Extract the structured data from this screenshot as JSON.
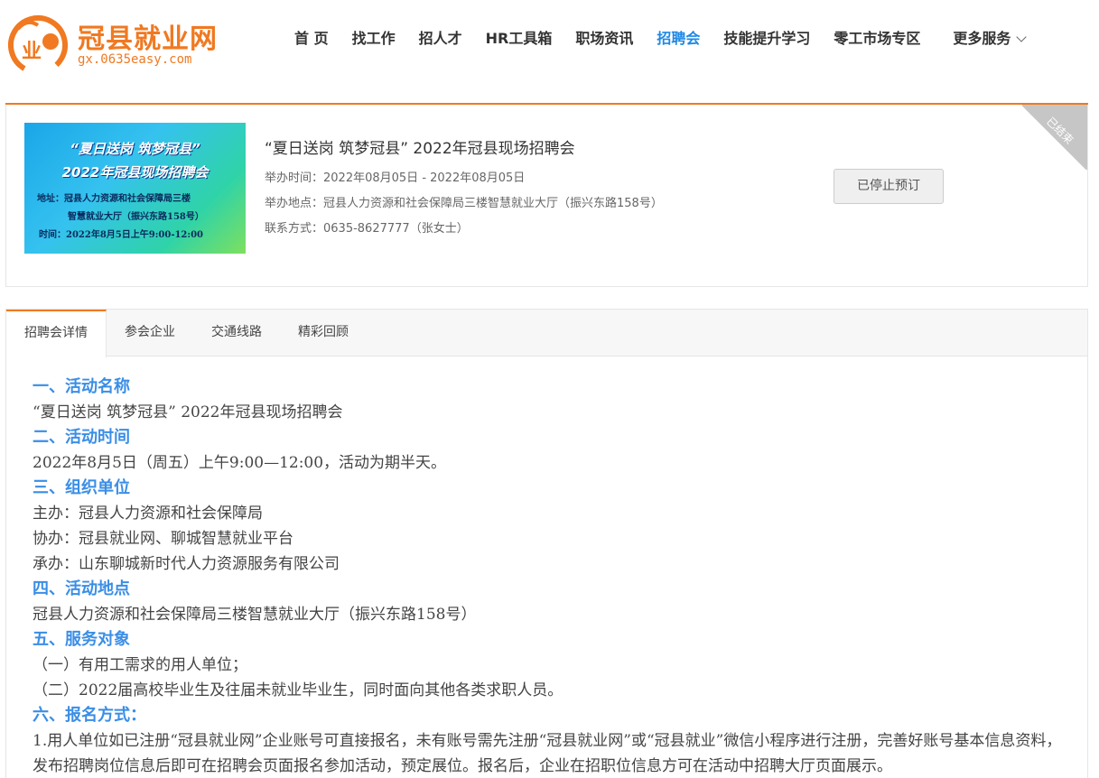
{
  "header": {
    "logo_title": "冠县就业网",
    "logo_url": "gx.0635easy.com",
    "logo_mark_text": "业",
    "nav": [
      "首 页",
      "找工作",
      "招人才",
      "HR工具箱",
      "职场资讯",
      "招聘会",
      "技能提升学习",
      "零工市场专区"
    ],
    "nav_active": "招聘会",
    "more_label": "更多服务"
  },
  "fair": {
    "banner": {
      "line1": "“夏日送岗  筑梦冠县”",
      "line2": "2022年冠县现场招聘会",
      "line3": "地址：冠县人力资源和社会保障局三楼",
      "line4": "智慧就业大厅（振兴东路158号）",
      "line5": "时间：2022年8月5日上午9:00-12:00"
    },
    "title": "“夏日送岗 筑梦冠县” 2022年冠县现场招聘会",
    "time_label": "举办时间：",
    "time_value": "2022年08月05日 - 2022年08月05日",
    "place_label": "举办地点：",
    "place_value": "冠县人力资源和社会保障局三楼智慧就业大厅（振兴东路158号）",
    "contact_label": "联系方式：",
    "contact_value": "0635-8627777（张女士）",
    "status_button": "已停止预订",
    "corner_badge": "已结束"
  },
  "tabs": [
    "招聘会详情",
    "参会企业",
    "交通线路",
    "精彩回顾"
  ],
  "active_tab": "招聘会详情",
  "content": {
    "s1_title": "一、活动名称",
    "s1_text": "“夏日送岗 筑梦冠县” 2022年冠县现场招聘会",
    "s2_title": "二、活动时间",
    "s2_text": "2022年8月5日（周五）上午9:00—12:00，活动为期半天。",
    "s3_title": "三、组织单位",
    "s3_host": "主办：冠县人力资源和社会保障局",
    "s3_co": "协办：冠县就业网、聊城智慧就业平台",
    "s3_org": "承办：山东聊城新时代人力资源服务有限公司",
    "s4_title": "四、活动地点",
    "s4_text": "冠县人力资源和社会保障局三楼智慧就业大厅（振兴东路158号）",
    "s5_title": "五、服务对象",
    "s5_a": "（一）有用工需求的用人单位；",
    "s5_b": "（二）2022届高校毕业生及往届未就业毕业生，同时面向其他各类求职人员。",
    "s6_title": "六、报名方式：",
    "s6_text": "1.用人单位如已注册“冠县就业网”企业账号可直接报名，未有账号需先注册“冠县就业网”或“冠县就业”微信小程序进行注册，完善好账号基本信息资料，发布招聘岗位信息后即可在招聘会页面报名参加活动，预定展位。报名后，企业在招职位信息方可在活动中招聘大厅页面展示。"
  },
  "colors": {
    "brand_orange": "#f07921",
    "accent_blue": "#1e88e5",
    "heading_blue": "#3a8ee6"
  }
}
